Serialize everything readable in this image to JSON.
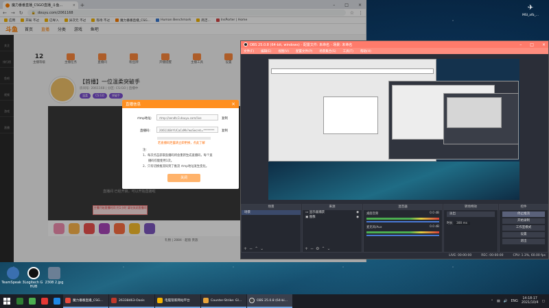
{
  "chrome": {
    "tab_title": "魔力番番直播_CSGO直播_斗鱼...",
    "url": "douyu.com/2061168",
    "bookmarks": [
      "应用",
      "开局 不过",
      "已导入",
      "异次元 不过",
      "等待 不过",
      "魔力番番直播_CSG...",
      "Human Benchmark",
      "简洁...",
      "InsPorter | Home"
    ]
  },
  "douyu": {
    "logo": "斗鱼",
    "nav": [
      "首页",
      "直播",
      "分类",
      "游戏",
      "鱼吧"
    ],
    "sidebar": [
      "关注",
      "排行榜",
      "鱼吧",
      "视频",
      "游戏",
      "直播"
    ],
    "stats": [
      {
        "value": "12",
        "label": "主播等级"
      },
      {
        "value": "",
        "label": "主播任务"
      },
      {
        "value": "",
        "label": "直播间"
      },
      {
        "value": "",
        "label": "粉丝牌"
      },
      {
        "value": "",
        "label": "开播提醒"
      },
      {
        "value": "",
        "label": "主播工具"
      },
      {
        "value": "",
        "label": "设置"
      }
    ],
    "room_title": "【首播】一位温柔突破手",
    "room_meta": "房间号: 2061168 | 分区: CS:GO | 直播中",
    "tags": [
      "温柔",
      "CS:GO",
      "突破手"
    ],
    "player_msg": "直播间 已经开启，可以开始直播啦",
    "red_notice": "主播开始直播时间 约1小时 请勿关闭直播间",
    "gift_count": "2884",
    "gift_foot": "礼物 | 2884 · 超值 贵族"
  },
  "dialog": {
    "title": "直播信息",
    "rtmp_label": "rtmp地址:",
    "rtmp_value": "rtmp://sendtc3.douyu.com/live",
    "key_label": "直播码:",
    "key_value": "2061168rYUCaCsMk?wsSecret=********",
    "copy": "复制",
    "warn": "若直播码泄露请立即更换，点此了解",
    "notes": [
      "注:",
      "1、每次点击获取直播码将会重新生成直播码，每个直",
      "播码仅能使用1次。",
      "2、只有切换推流码到了推流 rtmp地址发生变化。"
    ],
    "button": "关闭"
  },
  "obs": {
    "title": "OBS 25.0.8 (64-bit, windows) - 配置文件: 未命名 - 场景: 未命名",
    "menu": [
      "文件(F)",
      "编辑(E)",
      "视图(V)",
      "配置文件(P)",
      "场景集合(S)",
      "工具(T)",
      "帮助(H)"
    ],
    "docks": {
      "scenes": {
        "title": "场景",
        "items": [
          "场景"
        ]
      },
      "sources": {
        "title": "来源",
        "items": [
          "显示器捕获",
          "图像"
        ]
      },
      "mixer": {
        "title": "混音器",
        "items": [
          {
            "name": "桌面音频",
            "db": "0.0 dB"
          },
          {
            "name": "麦克风/Aux",
            "db": "0.0 dB"
          }
        ]
      },
      "transitions": {
        "title": "转场特效",
        "fade": "淡出",
        "duration_label": "时长",
        "duration": "300 ms"
      },
      "controls": {
        "title": "控件",
        "buttons": [
          "停止推流",
          "开始录制",
          "工作室模式",
          "设置",
          "退出"
        ]
      }
    },
    "status": {
      "live": "LIVE: 00:00:00",
      "rec": "REC: 00:00:00",
      "cpu": "CPU: 1.3%, 60.00 fps"
    }
  },
  "desktop": {
    "icons": [
      {
        "name": "TeamSpeak 3",
        "color": "#3a6fb0"
      },
      {
        "name": "Logitech G HUB",
        "color": "#111111"
      },
      {
        "name": "2308 2.jpg",
        "color": "#6b7f95"
      }
    ],
    "corner_icon": "MSI_afb_..."
  },
  "taskbar": {
    "apps": [
      {
        "label": "魔力番番直播_CSG...",
        "color": "#e84c3d"
      },
      {
        "label": "26338463-Oasis",
        "color": "#c0392b"
      },
      {
        "label": "电脑管家网站平台",
        "color": "#f5b400"
      },
      {
        "label": "Counter-Strike: Gl...",
        "color": "#e8a33a"
      },
      {
        "label": "OBS 25.0.8 (64-bi...",
        "color": "#444444"
      }
    ],
    "lang": "ENG",
    "time": "14:18:17",
    "date": "2021/10/4"
  }
}
